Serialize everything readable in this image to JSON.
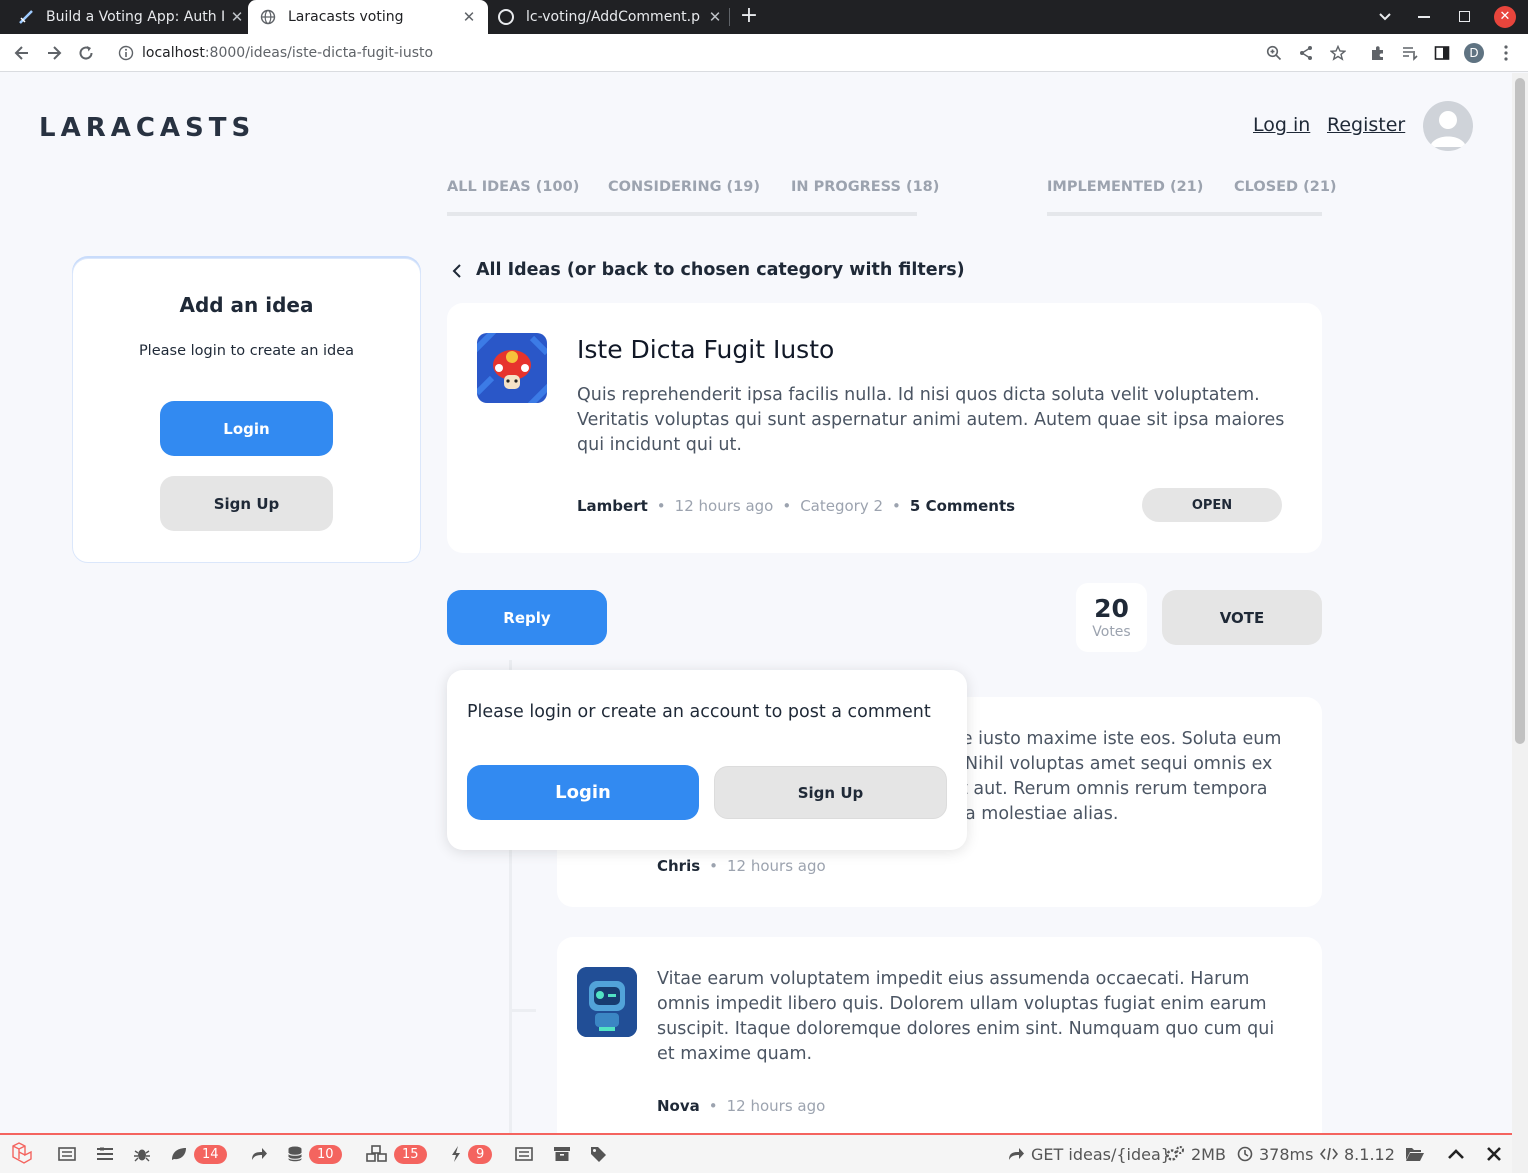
{
  "browser": {
    "tabs": [
      {
        "label": "Build a Voting App: Auth I"
      },
      {
        "label": "Laracasts voting"
      },
      {
        "label": "lc-voting/AddComment.p"
      }
    ],
    "url_host": "localhost",
    "url_path": ":8000/ideas/iste-dicta-fugit-iusto",
    "profile_initial": "D"
  },
  "header": {
    "logo": "LARACASTS",
    "login_link": "Log in",
    "register_link": "Register"
  },
  "filters": [
    {
      "label": "ALL IDEAS (100)"
    },
    {
      "label": "CONSIDERING (19)"
    },
    {
      "label": "IN PROGRESS (18)"
    },
    {
      "label": "IMPLEMENTED (21)"
    },
    {
      "label": "CLOSED (21)"
    }
  ],
  "sidebar": {
    "title": "Add an idea",
    "subtitle": "Please login to create an idea",
    "login_button": "Login",
    "signup_button": "Sign Up"
  },
  "back_link": "All Ideas (or back to chosen category with filters)",
  "idea": {
    "title": "Iste Dicta Fugit Iusto",
    "description": "Quis reprehenderit ipsa facilis nulla. Id nisi quos dicta soluta velit voluptatem. Veritatis voluptas qui sunt aspernatur animi autem. Autem quae sit ipsa maiores qui incidunt qui ut.",
    "author": "Lambert",
    "time": "12 hours ago",
    "category": "Category 2",
    "comments": "5 Comments",
    "status": "OPEN",
    "dot": "•"
  },
  "actions": {
    "reply_button": "Reply",
    "votes_count": "20",
    "votes_label": "Votes",
    "vote_button": "VOTE"
  },
  "login_popup": {
    "message": "Please login or create an account to post a comment",
    "login_button": "Login",
    "signup_button": "Sign Up"
  },
  "comments": [
    {
      "text_lines": [
        "re iusto maxime iste eos. Soluta eum",
        "Nihil voluptas amet sequi omnis ex",
        "t aut. Rerum omnis rerum tempora",
        "a molestiae alias."
      ],
      "author": "Chris",
      "time": "12 hours ago"
    },
    {
      "text": "Vitae earum voluptatem impedit eius assumenda occaecati. Harum omnis impedit libero quis. Dolorem ullam voluptas fugiat enim earum suscipit. Itaque doloremque dolores enim sint. Numquam quo cum qui et maxime quam.",
      "author": "Nova",
      "time": "12 hours ago"
    }
  ],
  "debugbar": {
    "badges": [
      "14",
      "10",
      "15",
      "9"
    ],
    "route": "GET ideas/{idea}",
    "memory": "2MB",
    "duration": "378ms",
    "php_version": "8.1.12"
  },
  "colors": {
    "primary_blue": "#328af1",
    "debug_red": "#f4645f",
    "chrome_dark": "#202124"
  }
}
